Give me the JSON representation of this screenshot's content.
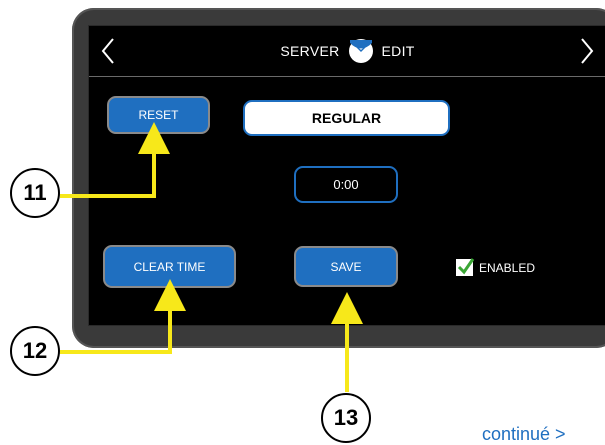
{
  "header": {
    "title_left": "SERVER",
    "title_right": "EDIT",
    "logo_icon": "brand-logo-icon",
    "prev_icon": "chevron-left-icon",
    "next_icon": "chevron-right-icon"
  },
  "buttons": {
    "reset": "RESET",
    "clear_time": "CLEAR TIME",
    "save": "SAVE"
  },
  "mode": {
    "value": "REGULAR"
  },
  "timer": {
    "value": "0:00"
  },
  "enabled": {
    "label": "ENABLED",
    "checked": true
  },
  "callouts": {
    "reset": "11",
    "clear_time": "12",
    "save": "13"
  },
  "footer": {
    "continue_text": "continué >"
  },
  "colors": {
    "accent": "#1f6fc0",
    "callout_line": "#f7e81a",
    "check": "#3aa635",
    "screen_bg": "#000000",
    "bezel": "#3a3a3a"
  }
}
